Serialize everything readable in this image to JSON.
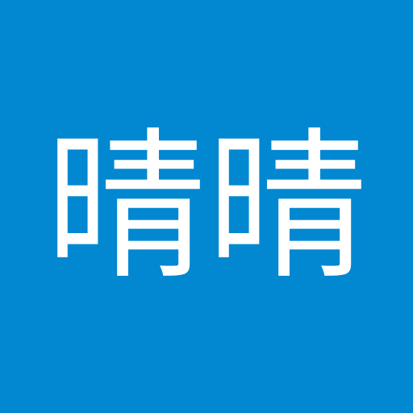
{
  "avatar": {
    "initials": "晴晴",
    "background_color": "#0288d1",
    "text_color": "#ffffff"
  }
}
